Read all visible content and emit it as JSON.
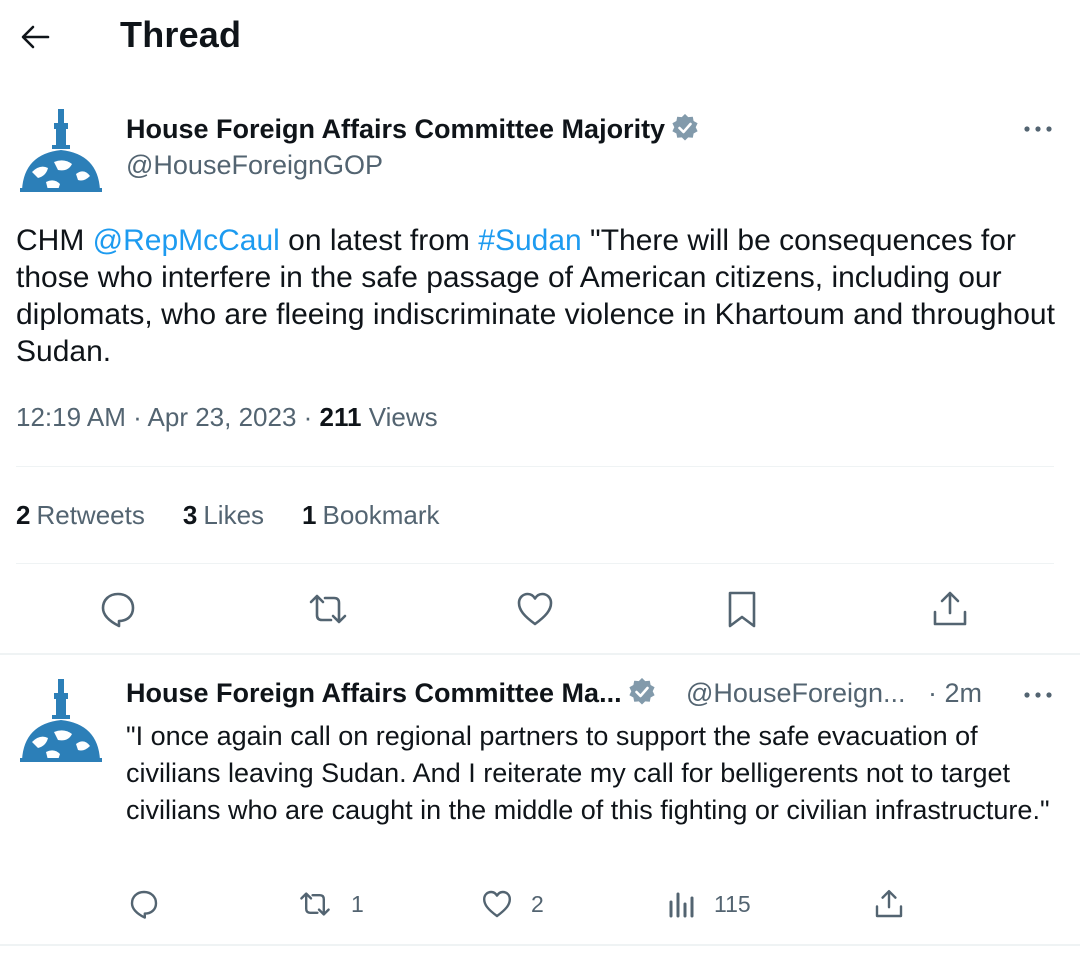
{
  "header": {
    "title": "Thread"
  },
  "tweet": {
    "author_name": "House Foreign Affairs Committee Majority",
    "handle": "@HouseForeignGOP",
    "text_prefix": "CHM ",
    "mention": "@RepMcCaul",
    "text_mid": " on latest from ",
    "hashtag": "#Sudan",
    "text_suffix": " \"There will be consequences for those who interfere in the safe passage of American citizens, including our diplomats, who are fleeing indiscriminate violence in Khartoum and throughout Sudan.",
    "timestamp": "12:19 AM · Apr 23, 2023 · ",
    "views_count": "211",
    "views_label": " Views",
    "retweets_count": "2",
    "retweets_label": "Retweets",
    "likes_count": "3",
    "likes_label": "Likes",
    "bookmarks_count": "1",
    "bookmarks_label": "Bookmark"
  },
  "reply": {
    "author_name": "House Foreign Affairs Committee Ma...",
    "handle": "@HouseForeign...",
    "time": "· 2m",
    "text": "\"I once again call on regional partners to support the safe evacuation of civilians leaving Sudan. And I reiterate my call for belligerents not to target civilians who are caught in the middle of this fighting or civilian infrastructure.\"",
    "retweets": "1",
    "likes": "2",
    "views": "115"
  },
  "colors": {
    "link": "#1d9bf0",
    "secondary": "#536471",
    "verified": "#829aab",
    "dome": "#2c7fb8"
  },
  "icons": [
    "back-arrow-icon",
    "verified-badge-icon",
    "more-icon",
    "reply-icon",
    "retweet-icon",
    "like-icon",
    "bookmark-icon",
    "share-icon",
    "views-icon",
    "capitol-dome-logo"
  ]
}
